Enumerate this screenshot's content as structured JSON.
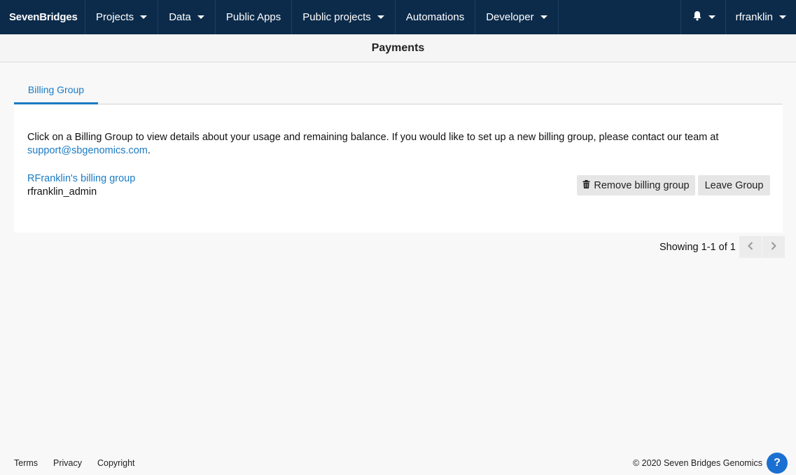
{
  "nav": {
    "logo": "SevenBridges",
    "items": [
      {
        "label": "Projects",
        "dropdown": true
      },
      {
        "label": "Data",
        "dropdown": true
      },
      {
        "label": "Public Apps",
        "dropdown": false
      },
      {
        "label": "Public projects",
        "dropdown": true
      },
      {
        "label": "Automations",
        "dropdown": false
      },
      {
        "label": "Developer",
        "dropdown": true
      }
    ],
    "notifications_icon": "bell-icon",
    "user": "rfranklin"
  },
  "page": {
    "title": "Payments"
  },
  "tabs": [
    {
      "label": "Billing Group",
      "active": true
    }
  ],
  "panel": {
    "intro_text": "Click on a Billing Group to view details about your usage and remaining balance. If you would like to set up a new billing group, please contact our team at ",
    "support_email": "support@sbgenomics.com",
    "intro_end": ".",
    "billing_group": {
      "name": "RFranklin's billing group",
      "owner": "rfranklin_admin"
    },
    "remove_button": "Remove billing group",
    "leave_button": "Leave Group"
  },
  "pagination": {
    "text": "Showing 1-1 of 1"
  },
  "footer": {
    "links": [
      "Terms",
      "Privacy",
      "Copyright"
    ],
    "copyright": "© 2020 Seven Bridges Genomics",
    "help_label": "?"
  },
  "colors": {
    "nav_bg": "#0c2b4b",
    "accent": "#1a7bc4",
    "help_bg": "#1a6fd0"
  }
}
